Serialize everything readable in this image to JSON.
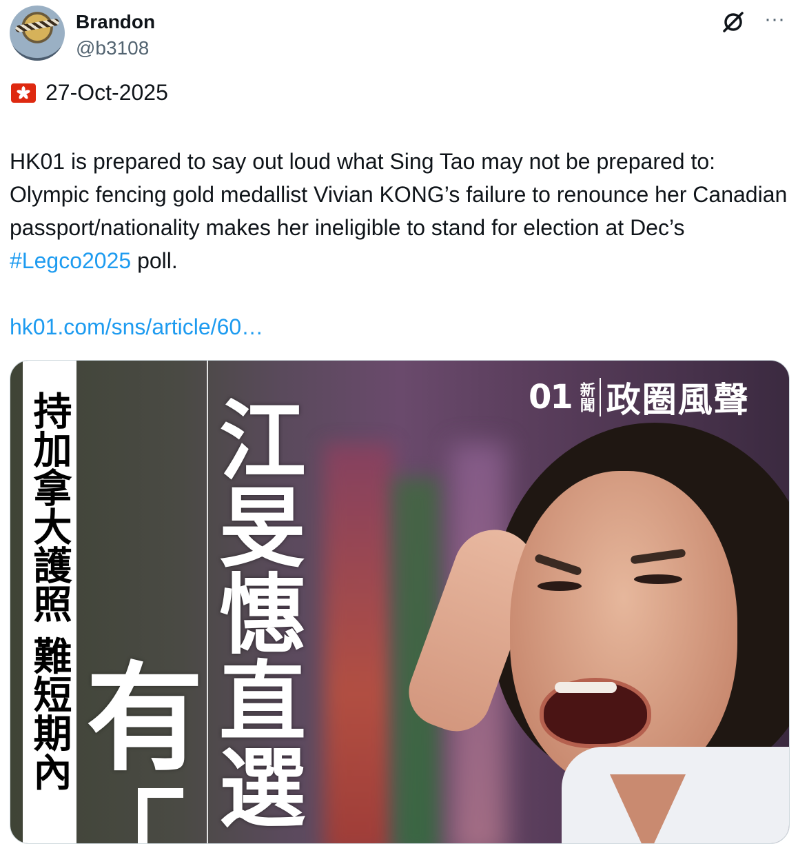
{
  "tweet": {
    "user": {
      "name": "Brandon",
      "handle": "@b3108"
    },
    "header_icons": [
      "grok-icon",
      "more-icon"
    ],
    "more_glyph": "···",
    "date": "27-Oct-2025",
    "flag": "hong-kong-flag",
    "body_pre": "HK01 is prepared to say out loud what Sing Tao may not be prepared to: Olympic fencing gold medallist Vivian KONG’s failure to renounce her Canadian passport/nationality makes her ineligible to stand for election at Dec’s ",
    "hashtag": "#Legco2025",
    "body_post": " poll.",
    "link": "hk01.com/sns/article/60…",
    "colors": {
      "link": "#1d9bf0",
      "text": "#0f1419",
      "secondary": "#536471"
    }
  },
  "media": {
    "logo_mark": "01",
    "logo_news": "新聞",
    "logo_title": "政圈風聲",
    "vertical_small": "持加拿大護照 難短期內",
    "vertical_big": "江旻憓直選",
    "big_char": "有"
  }
}
